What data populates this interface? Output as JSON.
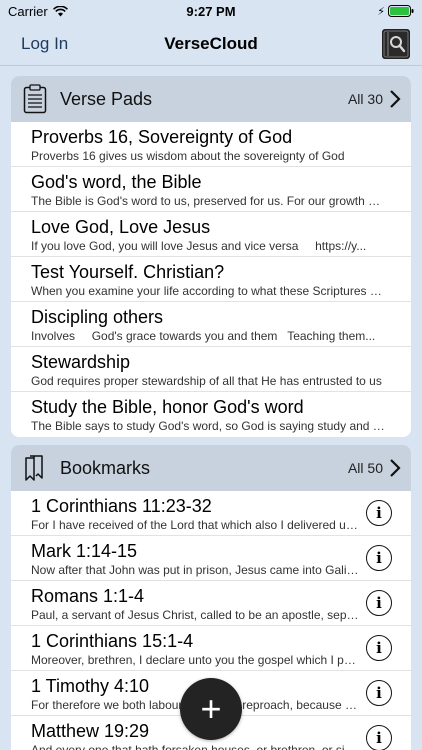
{
  "status": {
    "carrier": "Carrier",
    "time": "9:27 PM"
  },
  "nav": {
    "login_label": "Log In",
    "title": "VerseCloud",
    "search_icon": "bible-search-icon"
  },
  "verse_pads": {
    "title": "Verse Pads",
    "count": "All 30",
    "icon": "clipboard-icon",
    "items": [
      {
        "title": "Proverbs 16, Sovereignty of God",
        "subtitle": "Proverbs 16 gives us wisdom about the sovereignty of God"
      },
      {
        "title": "God's word, the Bible",
        "subtitle": "The Bible is God's word to us, preserved for us. For our growth and edification"
      },
      {
        "title": "Love God, Love Jesus",
        "subtitle": "If you love God, you will love Jesus and vice versa     https://y..."
      },
      {
        "title": "Test Yourself. Christian?",
        "subtitle": "When you examine your life according to what these Scriptures say"
      },
      {
        "title": "Discipling others",
        "subtitle": "Involves     God's grace towards you and them   Teaching them..."
      },
      {
        "title": "Stewardship",
        "subtitle": "God requires proper stewardship of all that He has entrusted to us"
      },
      {
        "title": "Study the Bible, honor God's word",
        "subtitle": "The Bible says to study God's word, so God is saying study and learn"
      }
    ]
  },
  "bookmarks": {
    "title": "Bookmarks",
    "count": "All 50",
    "icon": "bookmarks-icon",
    "items": [
      {
        "title": "1 Corinthians 11:23-32",
        "subtitle": "For I have received of the Lord that which also I delivered unto you"
      },
      {
        "title": "Mark 1:14-15",
        "subtitle": "Now after that John was put in prison, Jesus came into Galilee"
      },
      {
        "title": "Romans 1:1-4",
        "subtitle": "Paul, a servant of Jesus Christ, called to be an apostle, separated"
      },
      {
        "title": "1 Corinthians 15:1-4",
        "subtitle": "Moreover, brethren, I declare unto you the gospel which I preached"
      },
      {
        "title": "1 Timothy 4:10",
        "subtitle": "For therefore we both labour and suffer reproach, because we trust"
      },
      {
        "title": "Matthew 19:29",
        "subtitle": "And every one that hath forsaken houses, or brethren, or sisters"
      }
    ]
  },
  "fab": {
    "label": "+"
  }
}
